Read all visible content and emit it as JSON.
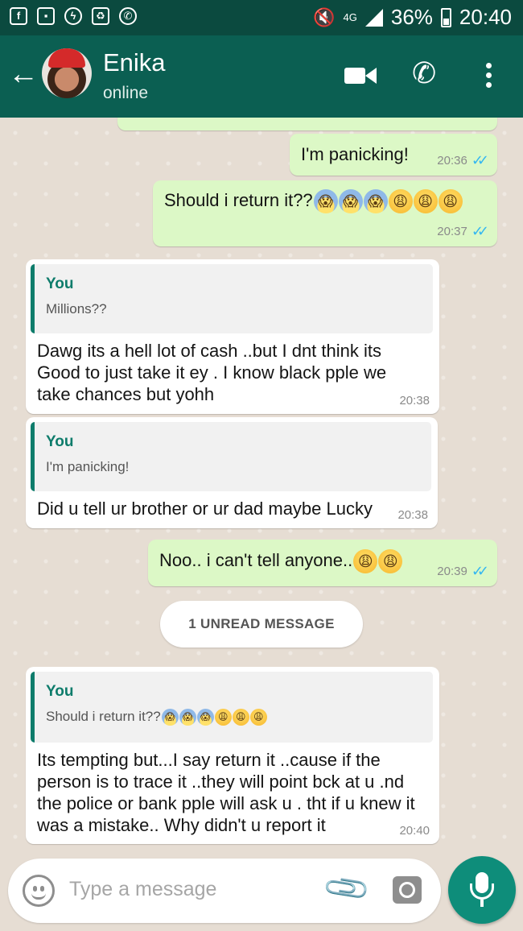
{
  "status_bar": {
    "network": "4G",
    "battery": "36%",
    "time": "20:40",
    "icons": [
      "facebook-icon",
      "gallery-icon",
      "messenger-icon",
      "cleanup-icon",
      "whatsapp-icon",
      "mute-icon",
      "signal-icon",
      "battery-icon"
    ]
  },
  "header": {
    "contact_name": "Enika",
    "contact_status": "online",
    "icons": [
      "back-arrow-icon",
      "video-call-icon",
      "voice-call-icon",
      "more-options-icon"
    ]
  },
  "messages": [
    {
      "direction": "out",
      "text": "I'm panicking!",
      "time": "20:36",
      "read": true
    },
    {
      "direction": "out",
      "text": "Should i return it??",
      "emojis": [
        "screaming",
        "screaming",
        "screaming",
        "weary",
        "weary",
        "weary"
      ],
      "time": "20:37",
      "read": true
    },
    {
      "direction": "in",
      "quote_author": "You",
      "quote_text": "Millions??",
      "lines": [
        "Dawg its a hell lot of cash ..but I dnt think its",
        "Good to just take it ey . I know black pple we",
        "take chances but yohh"
      ],
      "time": "20:38"
    },
    {
      "direction": "in",
      "quote_author": "You",
      "quote_text": "I'm panicking!",
      "text": "Did u tell ur brother or ur dad maybe Lucky",
      "time": "20:38"
    },
    {
      "direction": "out",
      "text": "Noo.. i can't tell anyone..",
      "emojis": [
        "weary",
        "weary"
      ],
      "time": "20:39",
      "read": true
    },
    {
      "direction": "in",
      "quote_author": "You",
      "quote_text": "Should i return it??",
      "quote_emojis": [
        "screaming",
        "screaming",
        "screaming",
        "weary",
        "weary",
        "weary"
      ],
      "lines": [
        "Its tempting but...I say return it ..cause if the",
        "person is to trace it ..they will point bck at u .nd",
        "the police or bank pple will ask u . tht if u knew it",
        "was a mistake.. Why didn't u report it"
      ],
      "time": "20:40"
    }
  ],
  "unread_banner": "1 UNREAD MESSAGE",
  "composer": {
    "placeholder": "Type a message",
    "icons": [
      "emoji-icon",
      "attach-icon",
      "camera-icon",
      "mic-icon"
    ]
  },
  "colors": {
    "header": "#0b5f52",
    "status_bar": "#0b4a3f",
    "outgoing_bubble": "#dcf8c6",
    "incoming_bubble": "#ffffff",
    "read_ticks": "#34b7f1",
    "mic_button": "#0e8d7a"
  }
}
